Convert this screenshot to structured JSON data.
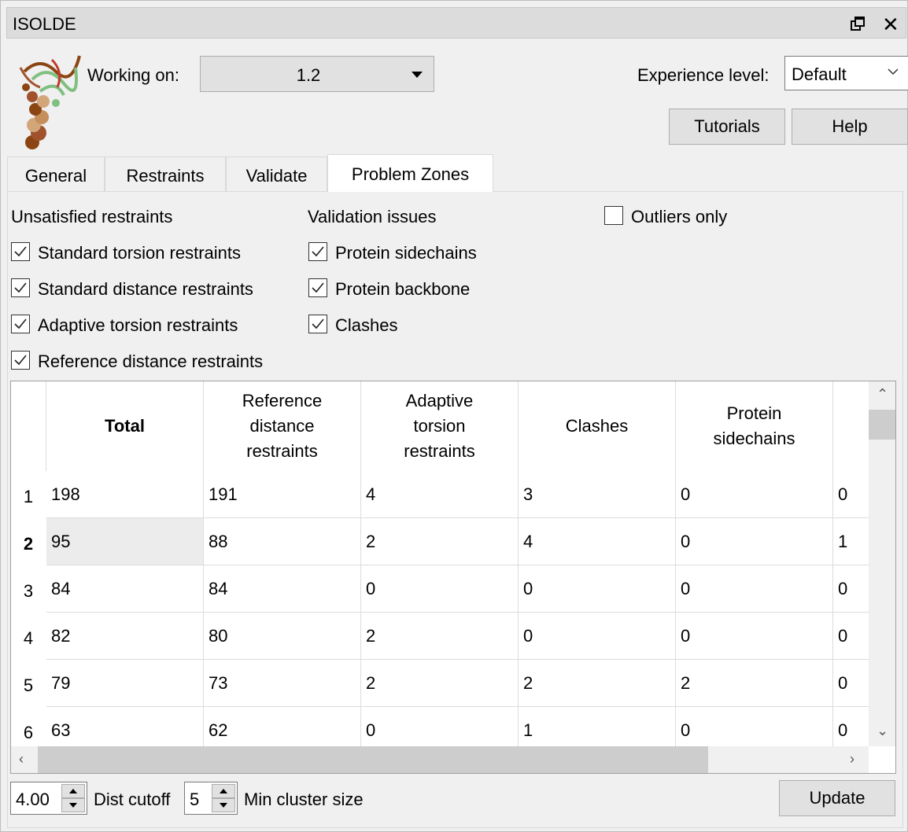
{
  "window": {
    "title": "ISOLDE"
  },
  "header": {
    "working_on_label": "Working on:",
    "working_on_value": "1.2",
    "experience_label": "Experience level:",
    "experience_value": "Default",
    "tutorials_label": "Tutorials",
    "help_label": "Help"
  },
  "tabs": [
    {
      "label": "General"
    },
    {
      "label": "Restraints"
    },
    {
      "label": "Validate"
    },
    {
      "label": "Problem Zones",
      "active": true
    }
  ],
  "filters": {
    "unsatisfied_heading": "Unsatisfied restraints",
    "unsatisfied": [
      {
        "label": "Standard torsion restraints",
        "checked": true
      },
      {
        "label": "Standard distance restraints",
        "checked": true
      },
      {
        "label": "Adaptive torsion restraints",
        "checked": true
      },
      {
        "label": "Reference distance restraints",
        "checked": true
      }
    ],
    "validation_heading": "Validation issues",
    "validation": [
      {
        "label": "Protein sidechains",
        "checked": true
      },
      {
        "label": "Protein backbone",
        "checked": true
      },
      {
        "label": "Clashes",
        "checked": true
      }
    ],
    "outliers_only": {
      "label": "Outliers only",
      "checked": false
    }
  },
  "table": {
    "columns": [
      "Total",
      "Reference distance restraints",
      "Adaptive torsion restraints",
      "Clashes",
      "Protein sidechains"
    ],
    "column_lines": [
      [
        "Total"
      ],
      [
        "Reference",
        "distance",
        "restraints"
      ],
      [
        "Adaptive",
        "torsion",
        "restraints"
      ],
      [
        "Clashes"
      ],
      [
        "Protein",
        "sidechains"
      ]
    ],
    "rows": [
      {
        "num": "1",
        "cells": [
          "198",
          "191",
          "4",
          "3",
          "0",
          "0"
        ]
      },
      {
        "num": "2",
        "cells": [
          "95",
          "88",
          "2",
          "4",
          "0",
          "1"
        ],
        "selected": true
      },
      {
        "num": "3",
        "cells": [
          "84",
          "84",
          "0",
          "0",
          "0",
          "0"
        ]
      },
      {
        "num": "4",
        "cells": [
          "82",
          "80",
          "2",
          "0",
          "0",
          "0"
        ]
      },
      {
        "num": "5",
        "cells": [
          "79",
          "73",
          "2",
          "2",
          "2",
          "0"
        ]
      },
      {
        "num": "6",
        "cells": [
          "63",
          "62",
          "0",
          "1",
          "0",
          "0"
        ]
      }
    ]
  },
  "bottom": {
    "dist_value": "4.00",
    "dist_label": "Dist cutoff",
    "cluster_value": "5",
    "cluster_label": "Min cluster size",
    "update_label": "Update"
  },
  "icons": {
    "float": "restore-window-icon",
    "close": "close-icon",
    "logo": "isolde-logo",
    "colors": {
      "logo_brown": "#8b4513",
      "logo_tan": "#d2a679",
      "logo_green": "#7fbf7f"
    }
  }
}
